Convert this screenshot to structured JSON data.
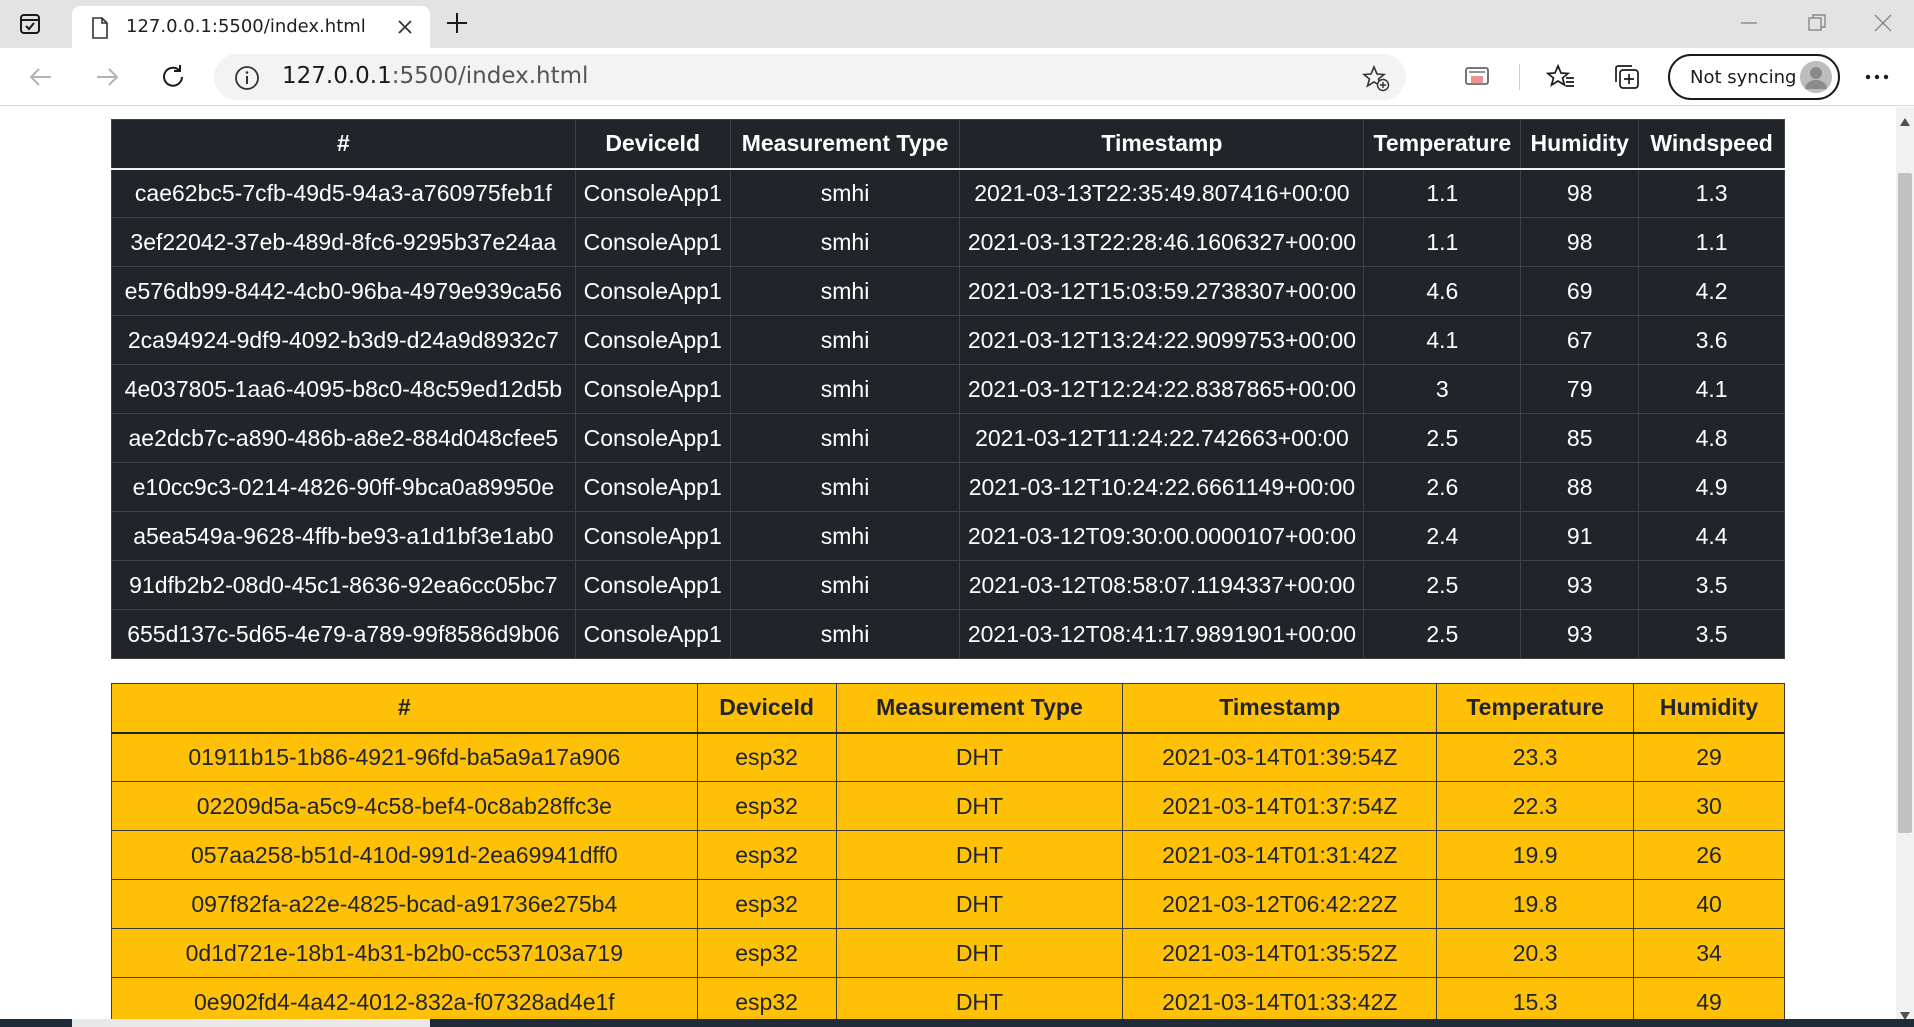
{
  "browser": {
    "tab_title": "127.0.0.1:5500/index.html",
    "url_host": "127.0.0.1",
    "url_path": ":5500/index.html",
    "sync_label": "Not syncing"
  },
  "table_dark": {
    "headers": [
      "#",
      "DeviceId",
      "Measurement Type",
      "Timestamp",
      "Temperature",
      "Humidity",
      "Windspeed"
    ],
    "rows": [
      [
        "cae62bc5-7cfb-49d5-94a3-a760975feb1f",
        "ConsoleApp1",
        "smhi",
        "2021-03-13T22:35:49.807416+00:00",
        "1.1",
        "98",
        "1.3"
      ],
      [
        "3ef22042-37eb-489d-8fc6-9295b37e24aa",
        "ConsoleApp1",
        "smhi",
        "2021-03-13T22:28:46.1606327+00:00",
        "1.1",
        "98",
        "1.1"
      ],
      [
        "e576db99-8442-4cb0-96ba-4979e939ca56",
        "ConsoleApp1",
        "smhi",
        "2021-03-12T15:03:59.2738307+00:00",
        "4.6",
        "69",
        "4.2"
      ],
      [
        "2ca94924-9df9-4092-b3d9-d24a9d8932c7",
        "ConsoleApp1",
        "smhi",
        "2021-03-12T13:24:22.9099753+00:00",
        "4.1",
        "67",
        "3.6"
      ],
      [
        "4e037805-1aa6-4095-b8c0-48c59ed12d5b",
        "ConsoleApp1",
        "smhi",
        "2021-03-12T12:24:22.8387865+00:00",
        "3",
        "79",
        "4.1"
      ],
      [
        "ae2dcb7c-a890-486b-a8e2-884d048cfee5",
        "ConsoleApp1",
        "smhi",
        "2021-03-12T11:24:22.742663+00:00",
        "2.5",
        "85",
        "4.8"
      ],
      [
        "e10cc9c3-0214-4826-90ff-9bca0a89950e",
        "ConsoleApp1",
        "smhi",
        "2021-03-12T10:24:22.6661149+00:00",
        "2.6",
        "88",
        "4.9"
      ],
      [
        "a5ea549a-9628-4ffb-be93-a1d1bf3e1ab0",
        "ConsoleApp1",
        "smhi",
        "2021-03-12T09:30:00.0000107+00:00",
        "2.4",
        "91",
        "4.4"
      ],
      [
        "91dfb2b2-08d0-45c1-8636-92ea6cc05bc7",
        "ConsoleApp1",
        "smhi",
        "2021-03-12T08:58:07.1194337+00:00",
        "2.5",
        "93",
        "3.5"
      ],
      [
        "655d137c-5d65-4e79-a789-99f8586d9b06",
        "ConsoleApp1",
        "smhi",
        "2021-03-12T08:41:17.9891901+00:00",
        "2.5",
        "93",
        "3.5"
      ]
    ]
  },
  "table_warning": {
    "headers": [
      "#",
      "DeviceId",
      "Measurement Type",
      "Timestamp",
      "Temperature",
      "Humidity"
    ],
    "rows": [
      [
        "01911b15-1b86-4921-96fd-ba5a9a17a906",
        "esp32",
        "DHT",
        "2021-03-14T01:39:54Z",
        "23.3",
        "29"
      ],
      [
        "02209d5a-a5c9-4c58-bef4-0c8ab28ffc3e",
        "esp32",
        "DHT",
        "2021-03-14T01:37:54Z",
        "22.3",
        "30"
      ],
      [
        "057aa258-b51d-410d-991d-2ea69941dff0",
        "esp32",
        "DHT",
        "2021-03-14T01:31:42Z",
        "19.9",
        "26"
      ],
      [
        "097f82fa-a22e-4825-bcad-a91736e275b4",
        "esp32",
        "DHT",
        "2021-03-12T06:42:22Z",
        "19.8",
        "40"
      ],
      [
        "0d1d721e-18b1-4b31-b2b0-cc537103a719",
        "esp32",
        "DHT",
        "2021-03-14T01:35:52Z",
        "20.3",
        "34"
      ],
      [
        "0e902fd4-4a42-4012-832a-f07328ad4e1f",
        "esp32",
        "DHT",
        "2021-03-14T01:33:42Z",
        "15.3",
        "49"
      ]
    ]
  },
  "icons": [
    "tab-actions-icon",
    "page-icon",
    "close-icon",
    "plus-icon",
    "minimize-icon",
    "restore-icon",
    "window-close-icon",
    "back-arrow-icon",
    "forward-arrow-icon",
    "refresh-icon",
    "info-icon",
    "add-favorite-icon",
    "read-aloud-icon",
    "favorites-icon",
    "collections-icon",
    "profile-avatar-icon",
    "more-icon"
  ],
  "colors": {
    "dark_table": "#212529",
    "warning_table": "#ffc107",
    "titlebar": "#e3e3e3"
  }
}
